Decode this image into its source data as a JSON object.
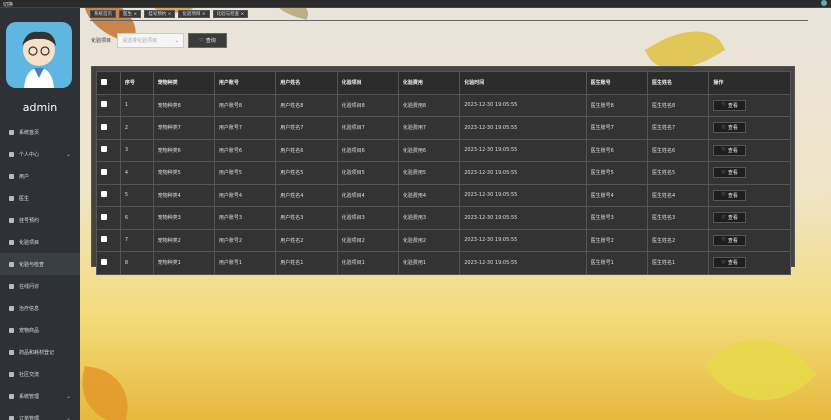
{
  "topbar": {
    "logo": "切换"
  },
  "sidebar": {
    "username": "admin",
    "items": [
      {
        "label": "系统首页",
        "icon": "home-icon",
        "arrow": false
      },
      {
        "label": "个人中心",
        "icon": "user-icon",
        "arrow": true
      },
      {
        "label": "用户",
        "icon": "users-icon",
        "arrow": false
      },
      {
        "label": "医生",
        "icon": "doctor-icon",
        "arrow": false
      },
      {
        "label": "挂号预约",
        "icon": "grid-icon",
        "arrow": false
      },
      {
        "label": "化验项目",
        "icon": "grid-icon",
        "arrow": false
      },
      {
        "label": "化验与检查",
        "icon": "grid-icon",
        "arrow": false
      },
      {
        "label": "在线问诊",
        "icon": "flag-icon",
        "arrow": false
      },
      {
        "label": "治疗信息",
        "icon": "grid-icon",
        "arrow": false
      },
      {
        "label": "宠物商品",
        "icon": "grid-icon",
        "arrow": false
      },
      {
        "label": "药品和耗材登记",
        "icon": "grid-icon",
        "arrow": false
      },
      {
        "label": "社区交流",
        "icon": "grid-icon",
        "arrow": false
      },
      {
        "label": "系统管理",
        "icon": "grid-icon",
        "arrow": true
      },
      {
        "label": "订单管理",
        "icon": "grid-icon",
        "arrow": true
      }
    ]
  },
  "tabs": [
    "系统首页",
    "医生 ×",
    "挂号预约 ×",
    "化验项目 ×",
    "化验与检查 ×"
  ],
  "search": {
    "label": "化验项目",
    "placeholder": "请选择化验项目",
    "button": "查询"
  },
  "table": {
    "headers": [
      "序号",
      "宠物种类",
      "用户账号",
      "用户姓名",
      "化验项目",
      "化验费用",
      "化验时间",
      "医生账号",
      "医生姓名",
      "操作"
    ],
    "view_label": "查看",
    "rows": [
      [
        "1",
        "宠物种类8",
        "用户账号8",
        "用户姓名8",
        "化验项目8",
        "化验费用8",
        "2023-12-30 19:05:55",
        "医生账号8",
        "医生姓名8"
      ],
      [
        "2",
        "宠物种类7",
        "用户账号7",
        "用户姓名7",
        "化验项目7",
        "化验费用7",
        "2023-12-30 19:05:55",
        "医生账号7",
        "医生姓名7"
      ],
      [
        "3",
        "宠物种类6",
        "用户账号6",
        "用户姓名6",
        "化验项目6",
        "化验费用6",
        "2023-12-30 19:05:55",
        "医生账号6",
        "医生姓名6"
      ],
      [
        "4",
        "宠物种类5",
        "用户账号5",
        "用户姓名5",
        "化验项目5",
        "化验费用5",
        "2023-12-30 19:05:55",
        "医生账号5",
        "医生姓名5"
      ],
      [
        "5",
        "宠物种类4",
        "用户账号4",
        "用户姓名4",
        "化验项目4",
        "化验费用4",
        "2023-12-30 19:05:55",
        "医生账号4",
        "医生姓名4"
      ],
      [
        "6",
        "宠物种类3",
        "用户账号3",
        "用户姓名3",
        "化验项目3",
        "化验费用3",
        "2023-12-30 19:05:55",
        "医生账号3",
        "医生姓名3"
      ],
      [
        "7",
        "宠物种类2",
        "用户账号2",
        "用户姓名2",
        "化验项目2",
        "化验费用2",
        "2023-12-30 19:05:55",
        "医生账号2",
        "医生姓名2"
      ],
      [
        "8",
        "宠物种类1",
        "用户账号1",
        "用户姓名1",
        "化验项目1",
        "化验费用1",
        "2023-12-30 19:05:55",
        "医生账号1",
        "医生姓名1"
      ]
    ]
  }
}
